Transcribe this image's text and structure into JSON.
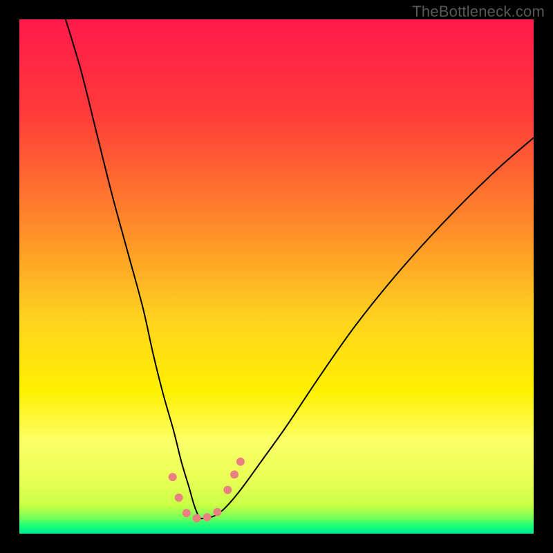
{
  "watermark": "TheBottleneck.com",
  "chart_data": {
    "type": "line",
    "title": "",
    "xlabel": "",
    "ylabel": "",
    "xlim": [
      0,
      100
    ],
    "ylim": [
      0,
      100
    ],
    "grid": false,
    "legend": false,
    "gradient_stops": [
      {
        "offset": 0,
        "color": "#ff1a4b"
      },
      {
        "offset": 0.18,
        "color": "#ff3a3a"
      },
      {
        "offset": 0.4,
        "color": "#ff8a2a"
      },
      {
        "offset": 0.58,
        "color": "#ffd21f"
      },
      {
        "offset": 0.72,
        "color": "#fff000"
      },
      {
        "offset": 0.82,
        "color": "#fbff66"
      },
      {
        "offset": 0.9,
        "color": "#e7ff55"
      },
      {
        "offset": 0.945,
        "color": "#c9ff45"
      },
      {
        "offset": 0.97,
        "color": "#73ff5a"
      },
      {
        "offset": 0.985,
        "color": "#19ff78"
      },
      {
        "offset": 1.0,
        "color": "#00e993"
      }
    ],
    "series": [
      {
        "name": "curve",
        "x": [
          9,
          12,
          15,
          18,
          21,
          24,
          26,
          28,
          30,
          31.5,
          33,
          34,
          35,
          36,
          38,
          40,
          43,
          47,
          52,
          58,
          65,
          73,
          82,
          92,
          100
        ],
        "y": [
          100,
          90,
          78,
          66,
          55,
          44,
          35,
          27,
          20,
          14,
          9,
          5.5,
          3.2,
          3.0,
          3.5,
          5.0,
          8.5,
          14,
          21,
          30,
          40,
          50,
          60,
          70,
          77
        ],
        "stroke": "#000000",
        "stroke_width": 2
      }
    ],
    "markers": {
      "name": "dots",
      "color": "#e98080",
      "radius": 6,
      "points": [
        {
          "x": 29.8,
          "y": 11.0
        },
        {
          "x": 31.0,
          "y": 7.0
        },
        {
          "x": 32.5,
          "y": 4.0
        },
        {
          "x": 34.5,
          "y": 3.0
        },
        {
          "x": 36.5,
          "y": 3.2
        },
        {
          "x": 38.5,
          "y": 4.2
        },
        {
          "x": 40.5,
          "y": 8.5
        },
        {
          "x": 41.8,
          "y": 11.5
        },
        {
          "x": 43.0,
          "y": 14.0
        }
      ]
    }
  }
}
